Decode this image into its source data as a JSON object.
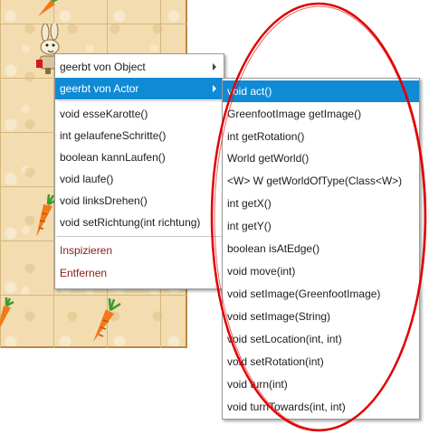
{
  "context_menu": {
    "items": [
      {
        "label": "geerbt von Object"
      },
      {
        "label": "geerbt von Actor"
      },
      {
        "label": "void esseKarotte()"
      },
      {
        "label": "int gelaufeneSchritte()"
      },
      {
        "label": "boolean kannLaufen()"
      },
      {
        "label": "void laufe()"
      },
      {
        "label": "void linksDrehen()"
      },
      {
        "label": "void setRichtung(int richtung)"
      },
      {
        "label": "Inspizieren"
      },
      {
        "label": "Entfernen"
      }
    ]
  },
  "actor_submenu": {
    "items": [
      {
        "label": "void act()"
      },
      {
        "label": "GreenfootImage getImage()"
      },
      {
        "label": "int getRotation()"
      },
      {
        "label": "World getWorld()"
      },
      {
        "label": "<W> W getWorldOfType(Class<W>)"
      },
      {
        "label": "int getX()"
      },
      {
        "label": "int getY()"
      },
      {
        "label": "boolean isAtEdge()"
      },
      {
        "label": "void move(int)"
      },
      {
        "label": "void setImage(GreenfootImage)"
      },
      {
        "label": "void setImage(String)"
      },
      {
        "label": "void setLocation(int, int)"
      },
      {
        "label": "void setRotation(int)"
      },
      {
        "label": "void turn(int)"
      },
      {
        "label": "void turnTowards(int, int)"
      }
    ]
  },
  "colors": {
    "highlight": "#0f8bd6",
    "annotation": "#e00000",
    "danger_text": "#8b1a10"
  }
}
